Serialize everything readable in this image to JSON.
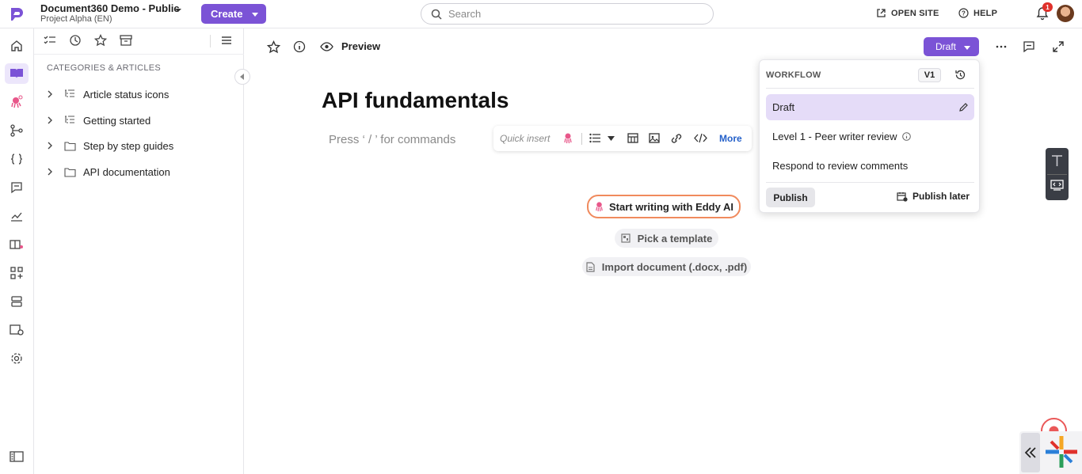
{
  "header": {
    "project_title": "Document360 Demo - Public",
    "project_subtitle": "Project Alpha (EN)",
    "create_label": "Create",
    "search_placeholder": "Search",
    "open_site_label": "OPEN SITE",
    "help_label": "HELP",
    "notification_count": "1"
  },
  "sidebar": {
    "heading": "CATEGORIES & ARTICLES",
    "items": [
      {
        "label": "Article status icons",
        "icon": "list-tree-icon"
      },
      {
        "label": "Getting started",
        "icon": "list-tree-icon"
      },
      {
        "label": "Step by step guides",
        "icon": "folder-icon"
      },
      {
        "label": "API documentation",
        "icon": "folder-icon"
      }
    ]
  },
  "editor": {
    "preview_label": "Preview",
    "status_button": "Draft",
    "article_title": "API fundamentals",
    "command_hint": "Press ‘ / ’ for commands",
    "quick_insert_label": "Quick insert",
    "more_label": "More",
    "eddy_button": "Start writing with Eddy AI",
    "template_button": "Pick a template",
    "import_button": "Import document (.docx, .pdf)"
  },
  "workflow": {
    "heading": "WORKFLOW",
    "version": "V1",
    "states": [
      {
        "label": "Draft",
        "selected": true
      },
      {
        "label": "Level 1 - Peer writer review",
        "selected": false
      },
      {
        "label": "Respond to review comments",
        "selected": false
      }
    ],
    "publish_label": "Publish",
    "publish_later_label": "Publish later"
  },
  "colors": {
    "accent": "#7b53d6",
    "selected_bg": "#e5dcf8",
    "eddy_border": "#f08a5d",
    "link": "#2460c9"
  }
}
